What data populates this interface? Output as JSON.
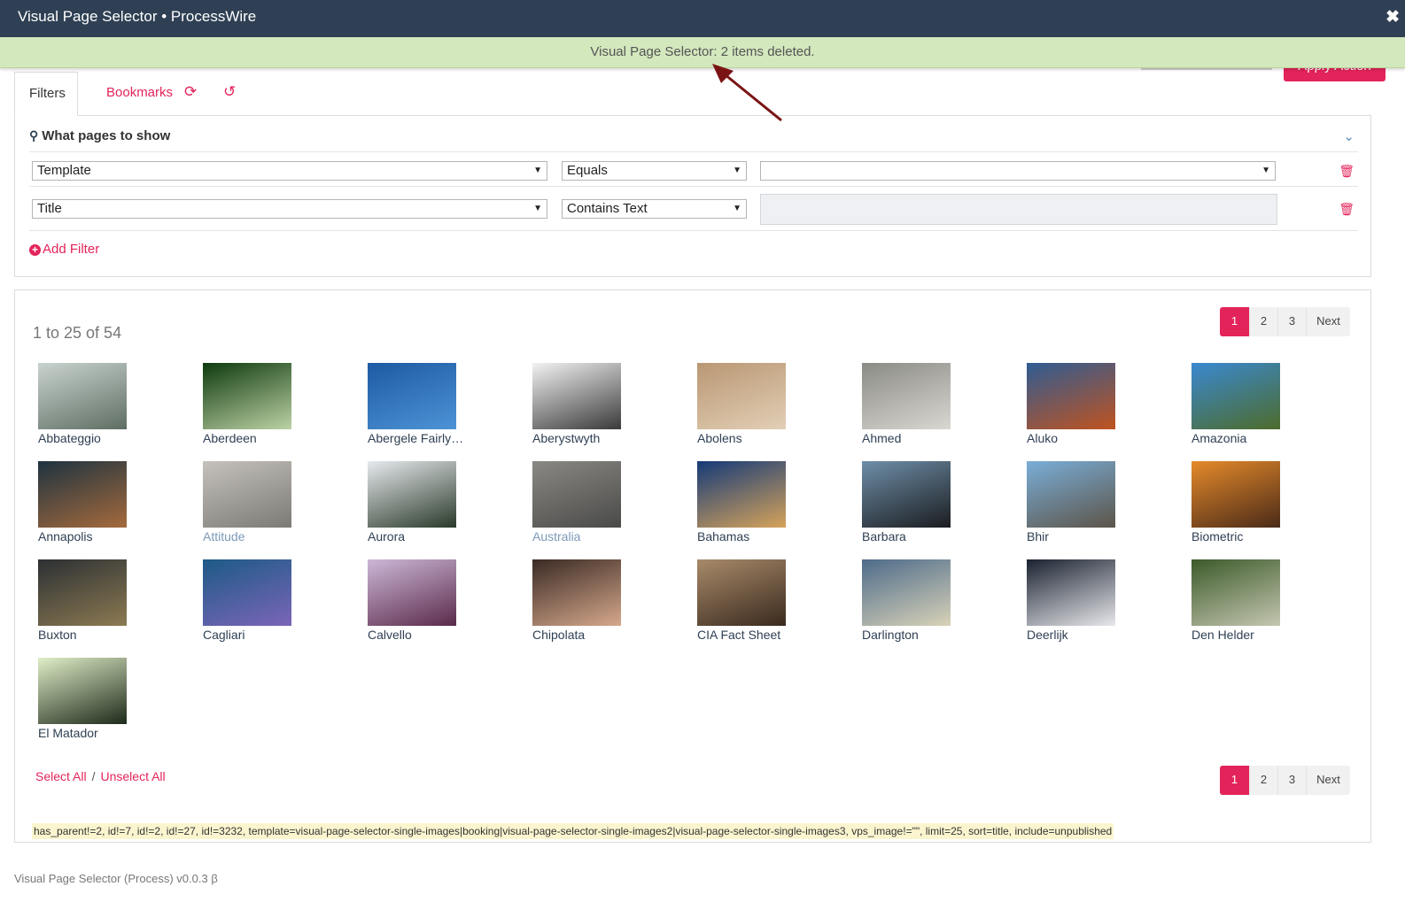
{
  "window": {
    "title": "Visual Page Selector • ProcessWire",
    "close_glyph": "✖"
  },
  "notice": {
    "text": "Visual Page Selector: 2 items deleted."
  },
  "apply_action": {
    "label": "Apply Action"
  },
  "tabs": {
    "filters": "Filters",
    "bookmarks": "Bookmarks"
  },
  "filters": {
    "heading": "What pages to show",
    "rows": [
      {
        "field": "Template",
        "operator": "Equals",
        "value": ""
      },
      {
        "field": "Title",
        "operator": "Contains Text",
        "value": ""
      }
    ],
    "add_filter": "Add Filter"
  },
  "results": {
    "count_text": "1 to 25 of 54",
    "pagination": {
      "current": "1",
      "pages": [
        "2",
        "3"
      ],
      "next": "Next"
    },
    "items": [
      {
        "label": "Abbateggio",
        "published": true,
        "colors": [
          "#c9d3cf",
          "#5f6e63"
        ]
      },
      {
        "label": "Aberdeen",
        "published": true,
        "colors": [
          "#0f3a0f",
          "#bcd2a5"
        ]
      },
      {
        "label": "Abergele Fairly…",
        "published": true,
        "colors": [
          "#1d5aa3",
          "#4d93d6"
        ]
      },
      {
        "label": "Aberystwyth",
        "published": true,
        "colors": [
          "#f2f2f2",
          "#3a3a3a"
        ]
      },
      {
        "label": "Abolens",
        "published": true,
        "colors": [
          "#b99773",
          "#e2cfb6"
        ]
      },
      {
        "label": "Ahmed",
        "published": true,
        "colors": [
          "#8b8b86",
          "#d9d7d1"
        ]
      },
      {
        "label": "Aluko",
        "published": true,
        "colors": [
          "#2f5c93",
          "#c0531f"
        ]
      },
      {
        "label": "Amazonia",
        "published": true,
        "colors": [
          "#3a89d1",
          "#4d6b2a"
        ]
      },
      {
        "label": "Annapolis",
        "published": true,
        "colors": [
          "#1e3340",
          "#a56a3c"
        ]
      },
      {
        "label": "Attitude",
        "published": false,
        "colors": [
          "#c4c2bb",
          "#7c7a74"
        ]
      },
      {
        "label": "Aurora",
        "published": true,
        "colors": [
          "#e7eaee",
          "#2a3a2a"
        ]
      },
      {
        "label": "Australia",
        "published": false,
        "colors": [
          "#8a8884",
          "#4a4a48"
        ]
      },
      {
        "label": "Bahamas",
        "published": true,
        "colors": [
          "#153a78",
          "#d6a35a"
        ]
      },
      {
        "label": "Barbara",
        "published": true,
        "colors": [
          "#6e8ea8",
          "#1b1d20"
        ]
      },
      {
        "label": "Bhir",
        "published": true,
        "colors": [
          "#7aaed8",
          "#5c5448"
        ]
      },
      {
        "label": "Biometric",
        "published": true,
        "colors": [
          "#e58a2a",
          "#4a2a18"
        ]
      },
      {
        "label": "Buxton",
        "published": true,
        "colors": [
          "#2c3033",
          "#8c7a52"
        ]
      },
      {
        "label": "Cagliari",
        "published": true,
        "colors": [
          "#1d5a86",
          "#7b65b8"
        ]
      },
      {
        "label": "Calvello",
        "published": true,
        "colors": [
          "#cdb8d8",
          "#5a2a4a"
        ]
      },
      {
        "label": "Chipolata",
        "published": true,
        "colors": [
          "#3a2a24",
          "#d6a88c"
        ]
      },
      {
        "label": "CIA Fact Sheet",
        "published": true,
        "colors": [
          "#a88a6a",
          "#3a2a1e"
        ]
      },
      {
        "label": "Darlington",
        "published": true,
        "colors": [
          "#4d6b8a",
          "#d8d2b8"
        ]
      },
      {
        "label": "Deerlijk",
        "published": true,
        "colors": [
          "#1a2230",
          "#e8e8ec"
        ]
      },
      {
        "label": "Den Helder",
        "published": true,
        "colors": [
          "#3c5a2a",
          "#c4c6b0"
        ]
      },
      {
        "label": "El Matador",
        "published": true,
        "colors": [
          "#e0eec8",
          "#1e2a1a"
        ]
      }
    ],
    "select_all": "Select All",
    "separator": "/",
    "unselect_all": "Unselect All",
    "selector_string": "has_parent!=2, id!=7, id!=2, id!=27, id!=3232, template=visual-page-selector-single-images|booking|visual-page-selector-single-images2|visual-page-selector-single-images3, vps_image!=\"\", limit=25, sort=title, include=unpublished"
  },
  "footer": {
    "text": "Visual Page Selector (Process) v0.0.3 β"
  },
  "colors": {
    "accent": "#e3245a",
    "header": "#2f4054",
    "notice_bg": "#d3e8bd",
    "link": "#2f4054"
  }
}
